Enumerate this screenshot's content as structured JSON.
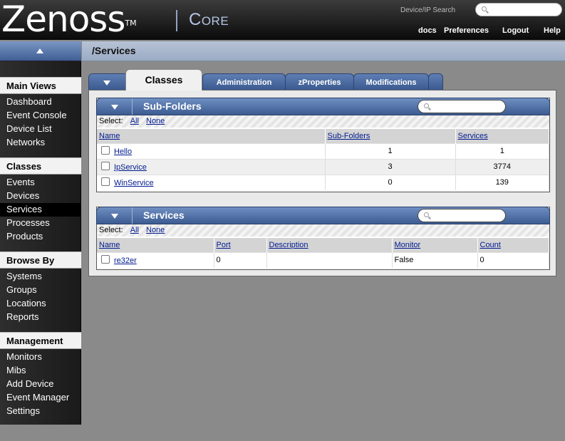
{
  "header": {
    "logo_text": "Zenoss",
    "logo_tm": "TM",
    "edition": "Core",
    "search_label": "Device/IP Search",
    "links": [
      "docs",
      "Preferences",
      "Logout",
      "Help"
    ]
  },
  "page_path": "/Services",
  "sidebar": {
    "sections": [
      {
        "title": "Main Views",
        "items": [
          "Dashboard",
          "Event Console",
          "Device List",
          "Networks"
        ]
      },
      {
        "title": "Classes",
        "items": [
          "Events",
          "Devices",
          "Services",
          "Processes",
          "Products"
        ]
      },
      {
        "title": "Browse By",
        "items": [
          "Systems",
          "Groups",
          "Locations",
          "Reports"
        ]
      },
      {
        "title": "Management",
        "items": [
          "Monitors",
          "Mibs",
          "Add Device",
          "Event Manager",
          "Settings"
        ]
      }
    ],
    "active_item": "Services"
  },
  "tabs": [
    "Classes",
    "Administration",
    "zProperties",
    "Modifications"
  ],
  "subfolders": {
    "title": "Sub-Folders",
    "select_label": "Select:",
    "select_all": "All",
    "select_none": "None",
    "columns": [
      "Name",
      "Sub-Folders",
      "Services"
    ],
    "rows": [
      [
        "Hello",
        "1",
        "1"
      ],
      [
        "IpService",
        "3",
        "3774"
      ],
      [
        "WinService",
        "0",
        "139"
      ]
    ]
  },
  "services": {
    "title": "Services",
    "select_label": "Select:",
    "select_all": "All",
    "select_none": "None",
    "columns": [
      "Name",
      "Port",
      "Description",
      "Monitor",
      "Count"
    ],
    "rows": [
      [
        "re32er",
        "0",
        "",
        "False",
        "0"
      ]
    ]
  }
}
